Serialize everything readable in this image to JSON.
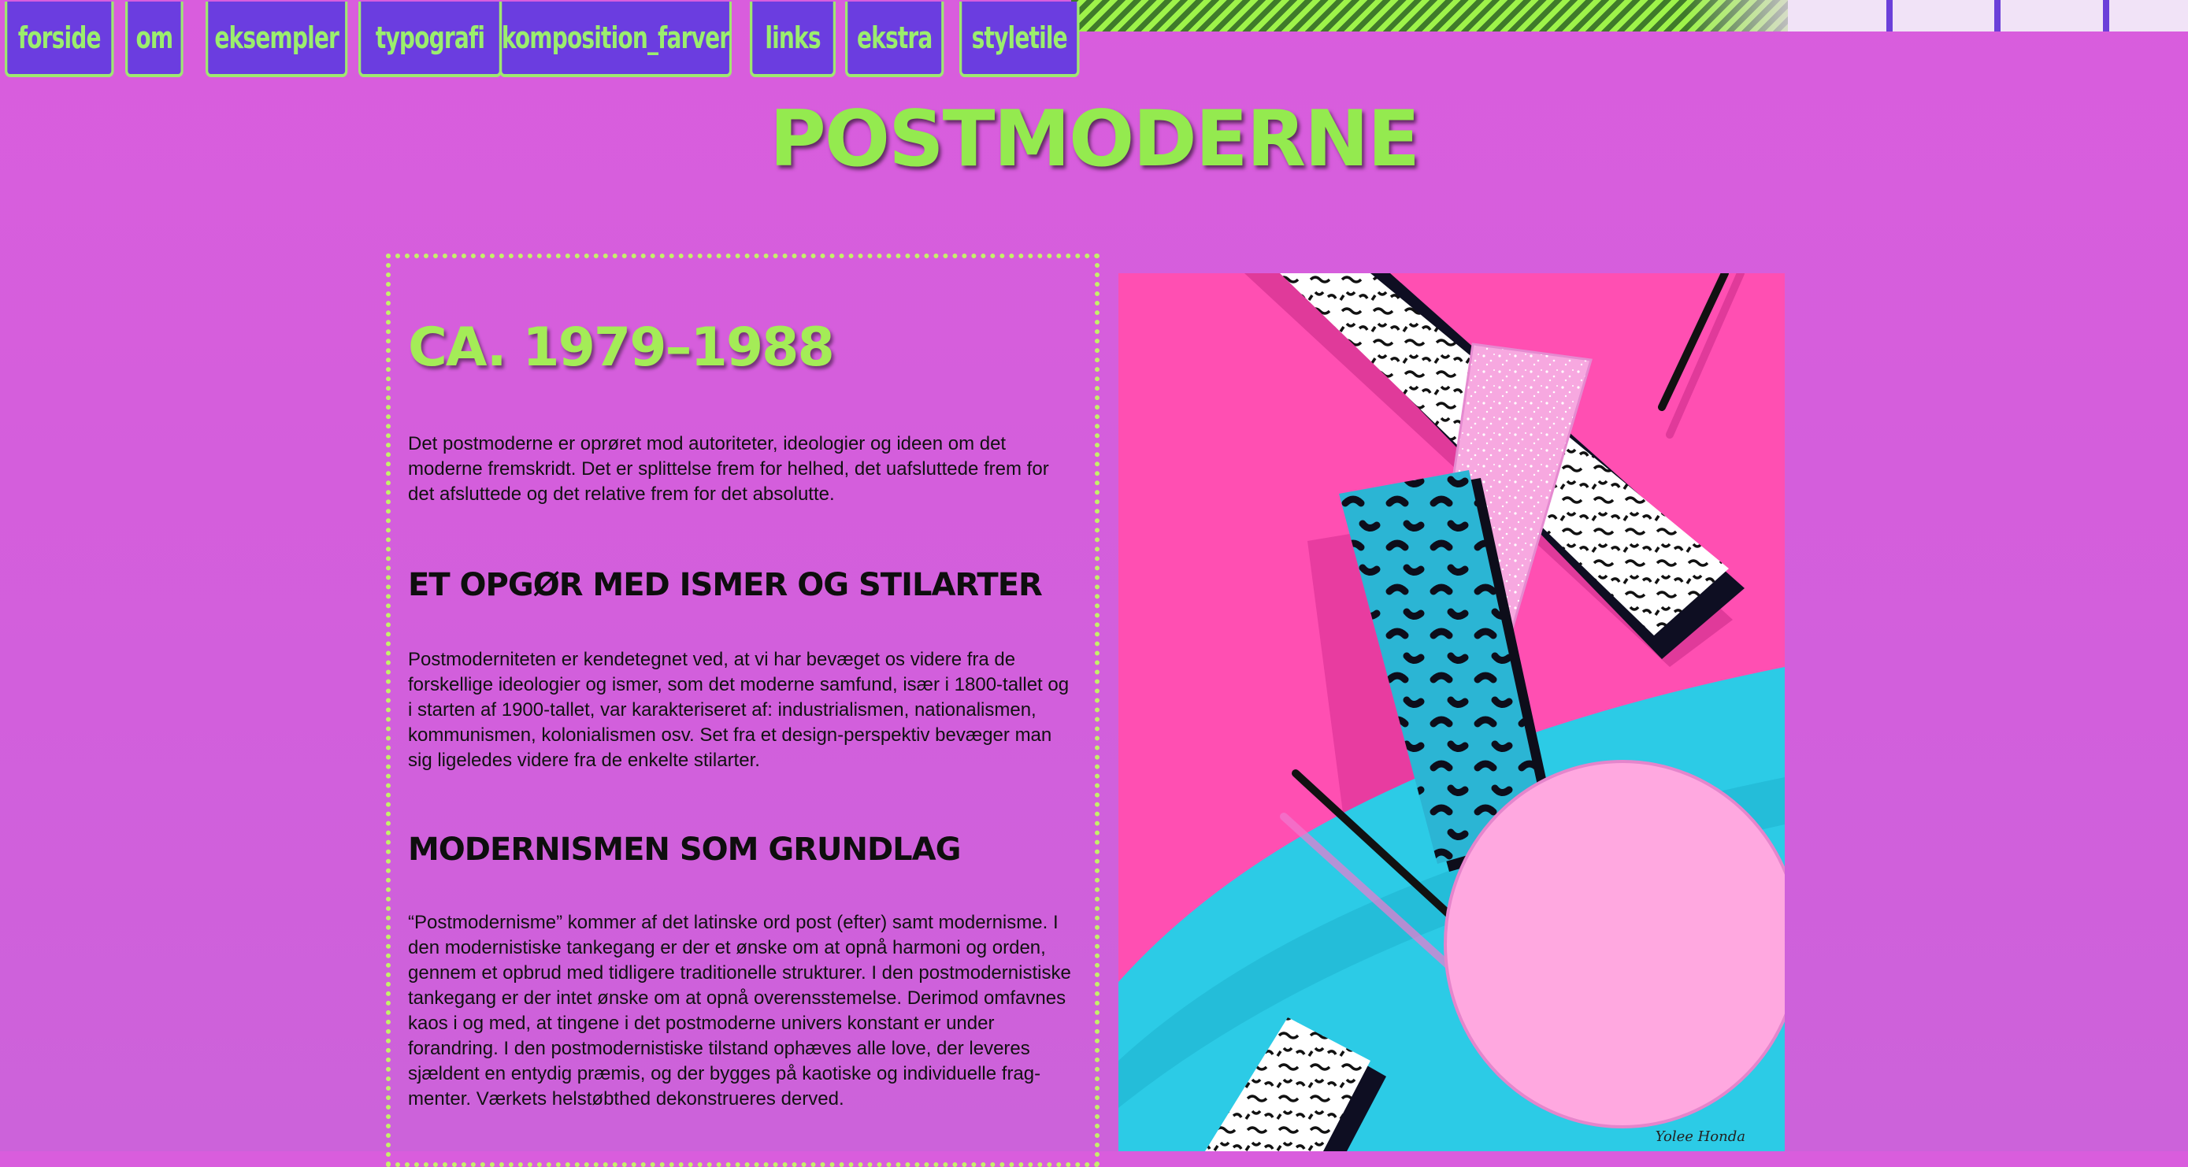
{
  "nav": {
    "items": [
      {
        "label": "forside"
      },
      {
        "label": "om"
      },
      {
        "label": "eksempler"
      },
      {
        "label": "typografi"
      },
      {
        "label": "komposition_farver"
      },
      {
        "label": "links"
      },
      {
        "label": "ekstra"
      },
      {
        "label": "styletile"
      }
    ]
  },
  "page": {
    "title": "POSTMODERNE"
  },
  "content": {
    "period": "CA. 1979–1988",
    "intro": "Det postmoderne er oprøret mod autoriteter, ideologier og ideen om det moderne fremskridt. Det er splittelse frem for helhed, det uafsluttede frem for det afsluttede og det relative frem for det absolutte.",
    "section1_heading": "ET OPGØR MED ISMER OG STILARTER",
    "section1_text": "Postmoderniteten er kendetegnet ved, at vi har bevæget os videre fra de forskellige ideologier og ismer, som det moderne samfund, især i 1800-tallet og i starten af 1900-tallet, var karakteriseret af: industrialismen, nationalismen, kommunismen, kolonialismen osv. Set fra et design-perspektiv bevæger man sig ligeledes videre fra de enkelte stilarter.",
    "section2_heading": "MODERNISMEN SOM GRUNDLAG",
    "section2_text": "“Postmodernisme” kommer af det latinske ord post (efter) samt modernisme. I den modernistiske tankegang er der et ønske om at opnå harmoni og orden, gennem et opbrud med tidligere traditionelle strukturer. I den postmodernistiske tankegang er der intet ønske om at opnå overensstemelse. Derimod omfavnes kaos i og med, at tingene i det postmoderne univers konstant er under forandring. I den postmodernistiske tilstand ophæves alle love, der leveres sjældent en entydig præmis, og der bygges på kaotiske og individuelle frag-menter. Værkets helstøbthed dekonstrueres derved."
  },
  "artwork": {
    "signature": "Yolee Honda"
  },
  "colors": {
    "background": "#d95ddd",
    "nav_bg": "#6b3de0",
    "nav_text": "#9bee6d",
    "title": "#94ea4f",
    "border": "#c4f06a",
    "art_pink": "#ff4fb2",
    "art_cyan": "#2ccbe6"
  }
}
